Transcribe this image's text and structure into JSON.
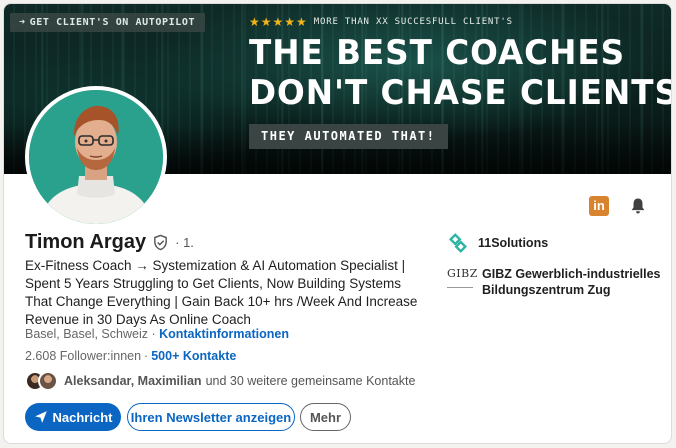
{
  "banner": {
    "autopilot_pill": "GET CLIENT'S ON AUTOPILOT",
    "stars": "★★★★★",
    "rating_text": "MORE THAN XX SUCCESFULL CLIENT'S",
    "headline_line1": "THE BEST COACHES",
    "headline_line2": "DON'T CHASE CLIENTS",
    "headline_dot": ".",
    "subtag": "THEY AUTOMATED THAT!"
  },
  "profile": {
    "name": "Timon Argay",
    "degree": "· 1.",
    "headline": "Ex-Fitness Coach → Systemization & AI Automation Specialist | Spent 5 Years Struggling to Get Clients, Now Building Systems That Change Everything | Gain Back 10+ hrs /Week And Increase Revenue in 30 Days As Online Coach",
    "location": "Basel, Basel, Schweiz",
    "location_sep": " · ",
    "contact_info": "Kontaktinformationen",
    "followers": "2.608 Follower:innen",
    "followers_sep": "·",
    "connections": "500+ Kontakte",
    "mutual_names": "Aleksandar, Maximilian",
    "mutual_rest": "und 30 weitere gemeinsame Kontakte"
  },
  "actions": {
    "message": "Nachricht",
    "newsletter": "Ihren Newsletter anzeigen",
    "more": "Mehr"
  },
  "organizations": [
    {
      "name": "11Solutions",
      "logo": "11solutions-logo"
    },
    {
      "name": "GIBZ Gewerblich-industrielles Bildungszentrum Zug",
      "logo": "gibz-logo",
      "logo_text": "GIBZ"
    }
  ],
  "icons": {
    "linkedin": "in",
    "bell": "bell-icon",
    "verify": "shield-check-icon",
    "send": "send-icon"
  },
  "colors": {
    "brand_blue": "#0a66c2",
    "accent_teal": "#2aa18d",
    "star_gold": "#f2b318",
    "linkedin_icon_bg": "#d8832e"
  }
}
